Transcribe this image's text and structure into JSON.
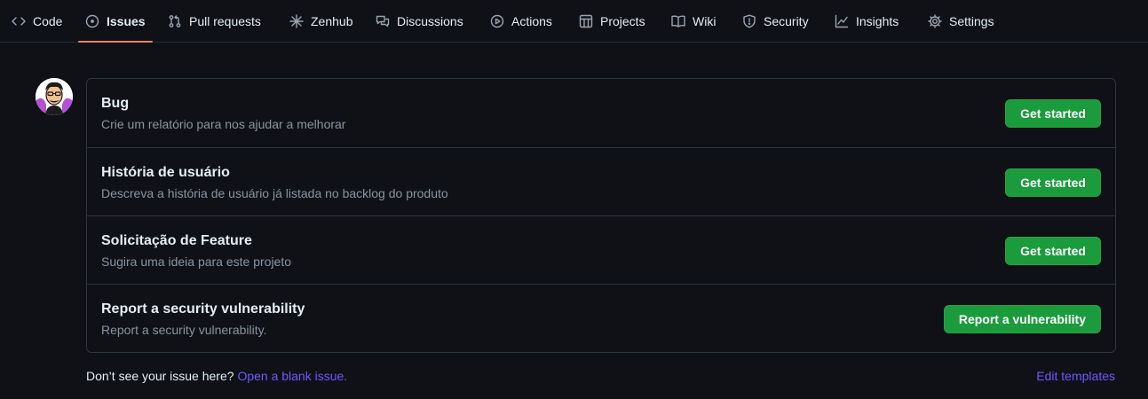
{
  "nav": {
    "tabs": [
      {
        "label": "Code",
        "icon": "code-icon"
      },
      {
        "label": "Issues",
        "icon": "issue-icon",
        "active": true
      },
      {
        "label": "Pull requests",
        "icon": "pull-request-icon"
      },
      {
        "label": "Zenhub",
        "icon": "zenhub-icon"
      },
      {
        "label": "Discussions",
        "icon": "discussions-icon"
      },
      {
        "label": "Actions",
        "icon": "actions-icon"
      },
      {
        "label": "Projects",
        "icon": "projects-icon"
      },
      {
        "label": "Wiki",
        "icon": "wiki-icon"
      },
      {
        "label": "Security",
        "icon": "shield-icon"
      },
      {
        "label": "Insights",
        "icon": "graph-icon"
      },
      {
        "label": "Settings",
        "icon": "gear-icon"
      }
    ]
  },
  "templates": [
    {
      "title": "Bug",
      "description": "Crie um relatório para nos ajudar a melhorar",
      "button": "Get started"
    },
    {
      "title": "História de usuário",
      "description": "Descreva a história de usuário já listada no backlog do produto",
      "button": "Get started"
    },
    {
      "title": "Solicitação de Feature",
      "description": "Sugira uma ideia para este projeto",
      "button": "Get started"
    },
    {
      "title": "Report a security vulnerability",
      "description": "Report a security vulnerability.",
      "button": "Report a vulnerability"
    }
  ],
  "footer": {
    "prompt": "Don’t see your issue here?",
    "blank_issue_link": "Open a blank issue.",
    "edit_templates_link": "Edit templates"
  },
  "colors": {
    "background": "#0f1117",
    "accent_underline": "#f78166",
    "button_green": "#1a9b3c",
    "link": "#7057ff"
  }
}
